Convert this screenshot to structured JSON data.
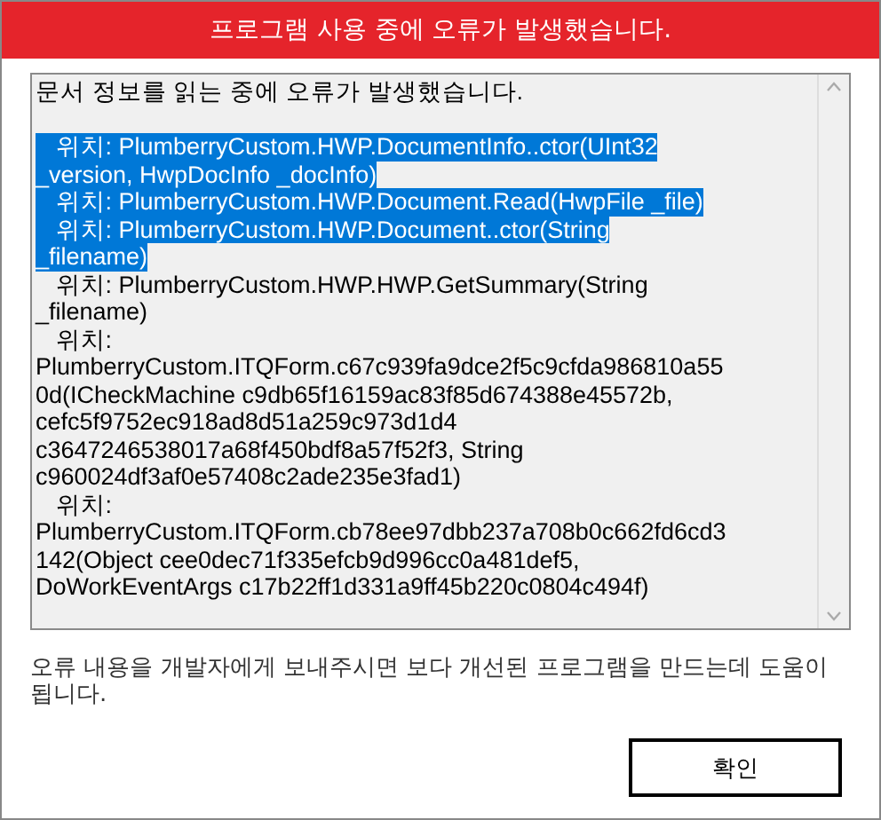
{
  "window": {
    "title": "프로그램 사용 중에 오류가 발생했습니다."
  },
  "details": {
    "heading": "문서 정보를 읽는 중에 오류가 발생했습니다.",
    "lines": [
      {
        "text": "   위치: PlumberryCustom.HWP.DocumentInfo..ctor(UInt32",
        "selected": true
      },
      {
        "text": "_version, HwpDocInfo _docInfo)",
        "selected": true
      },
      {
        "text": "   위치: PlumberryCustom.HWP.Document.Read(HwpFile _file)",
        "selected": true
      },
      {
        "text": "   위치: PlumberryCustom.HWP.Document..ctor(String",
        "selected": true
      },
      {
        "text": "_filename)",
        "selected": true
      },
      {
        "text": "   위치: PlumberryCustom.HWP.HWP.GetSummary(String",
        "selected": false
      },
      {
        "text": "_filename)",
        "selected": false
      },
      {
        "text": "   위치:",
        "selected": false
      },
      {
        "text": "PlumberryCustom.ITQForm.c67c939fa9dce2f5c9cfda986810a55",
        "selected": false
      },
      {
        "text": "0d(ICheckMachine c9db65f16159ac83f85d674388e45572b,",
        "selected": false
      },
      {
        "text": "cefc5f9752ec918ad8d51a259c973d1d4",
        "selected": false
      },
      {
        "text": "c3647246538017a68f450bdf8a57f52f3, String",
        "selected": false
      },
      {
        "text": "c960024df3af0e57408c2ade235e3fad1)",
        "selected": false
      },
      {
        "text": "   위치:",
        "selected": false
      },
      {
        "text": "PlumberryCustom.ITQForm.cb78ee97dbb237a708b0c662fd6cd3",
        "selected": false
      },
      {
        "text": "142(Object cee0dec71f335efcb9d996cc0a481def5,",
        "selected": false
      },
      {
        "text": "DoWorkEventArgs c17b22ff1d331a9ff45b220c0804c494f)",
        "selected": false
      }
    ]
  },
  "message": "오류 내용을 개발자에게 보내주시면 보다 개선된 프로그램을 만드는데 도움이 됩니다.",
  "buttons": [
    "확인"
  ]
}
